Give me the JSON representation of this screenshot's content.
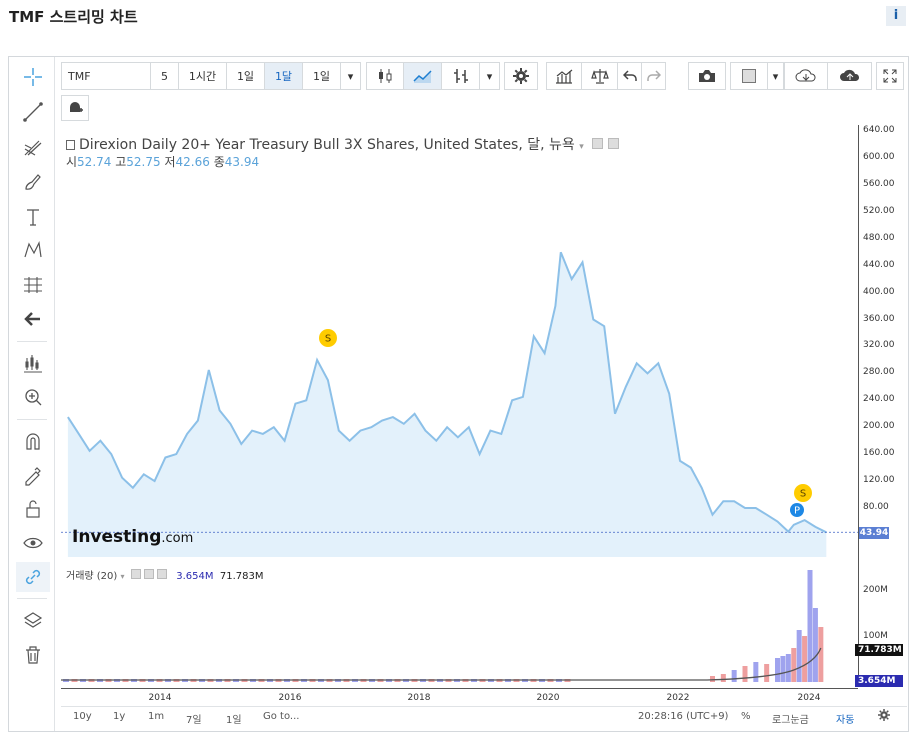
{
  "page": {
    "title": "TMF 스트리밍 차트",
    "info": "i"
  },
  "toolbar": {
    "symbol": "TMF",
    "intervals": [
      "5",
      "1시간",
      "1일",
      "1달",
      "1일"
    ],
    "selected_interval": "1달"
  },
  "legend": {
    "title": "Direxion Daily 20+ Year Treasury Bull 3X Shares, United States, 달, 뉴욕",
    "open_label": "시",
    "open": "52.74",
    "high_label": "고",
    "high": "52.75",
    "low_label": "저",
    "low": "42.66",
    "close_label": "종",
    "close": "43.94"
  },
  "volume_legend": {
    "label": "거래량 (20)",
    "v1": "3.654M",
    "v2": "71.783M"
  },
  "price_axis": [
    "640.00",
    "600.00",
    "560.00",
    "520.00",
    "480.00",
    "440.00",
    "400.00",
    "360.00",
    "320.00",
    "280.00",
    "240.00",
    "200.00",
    "160.00",
    "120.00",
    "80.00"
  ],
  "last_price": "43.94",
  "volume_axis": [
    "200M",
    "100M"
  ],
  "volume_tags": [
    "71.783M",
    "3.654M"
  ],
  "x_axis": [
    "2014",
    "2016",
    "2018",
    "2020",
    "2022",
    "2024"
  ],
  "markers": {
    "s": "S",
    "p": "P"
  },
  "watermark": {
    "brand": "Investing",
    "suffix": ".com"
  },
  "bottom": {
    "ranges": [
      "10y",
      "1y",
      "1m",
      "7일",
      "1일"
    ],
    "goto": "Go to...",
    "time": "20:28:16 (UTC+9)",
    "percent": "%",
    "log": "로그눈금",
    "auto": "자동"
  },
  "colors": {
    "accent": "#1565c0",
    "line": "#8cc0e8",
    "fill": "#e3f1fb",
    "vol_up": "#9fa3ee",
    "vol_down": "#ee9f9f"
  },
  "chart_data": {
    "type": "area",
    "ylim": [
      40,
      640
    ],
    "x": [
      "2012-08",
      "2012-10",
      "2012-12",
      "2013-02",
      "2013-04",
      "2013-06",
      "2013-08",
      "2013-10",
      "2013-12",
      "2014-02",
      "2014-04",
      "2014-06",
      "2014-08",
      "2014-10",
      "2014-12",
      "2015-02",
      "2015-04",
      "2015-06",
      "2015-08",
      "2015-10",
      "2015-12",
      "2016-02",
      "2016-04",
      "2016-06",
      "2016-08",
      "2016-10",
      "2016-12",
      "2017-02",
      "2017-04",
      "2017-06",
      "2017-08",
      "2017-10",
      "2017-12",
      "2018-02",
      "2018-04",
      "2018-06",
      "2018-08",
      "2018-10",
      "2018-12",
      "2019-02",
      "2019-04",
      "2019-06",
      "2019-08",
      "2019-10",
      "2019-12",
      "2020-02",
      "2020-03",
      "2020-05",
      "2020-07",
      "2020-09",
      "2020-11",
      "2021-01",
      "2021-03",
      "2021-05",
      "2021-07",
      "2021-09",
      "2021-11",
      "2022-01",
      "2022-03",
      "2022-05",
      "2022-07",
      "2022-09",
      "2022-11",
      "2023-01",
      "2023-03",
      "2023-05",
      "2023-07",
      "2023-09",
      "2023-10",
      "2023-12",
      "2024-02",
      "2024-04"
    ],
    "values": [
      215,
      190,
      165,
      180,
      160,
      125,
      110,
      130,
      120,
      155,
      160,
      190,
      210,
      285,
      225,
      205,
      175,
      195,
      190,
      200,
      180,
      235,
      240,
      300,
      270,
      195,
      180,
      195,
      200,
      210,
      215,
      205,
      220,
      195,
      180,
      200,
      185,
      200,
      160,
      195,
      190,
      240,
      245,
      335,
      310,
      380,
      460,
      420,
      445,
      360,
      350,
      220,
      260,
      295,
      280,
      295,
      250,
      150,
      140,
      110,
      70,
      90,
      90,
      80,
      80,
      70,
      60,
      45,
      55,
      62,
      52,
      43.94
    ]
  }
}
